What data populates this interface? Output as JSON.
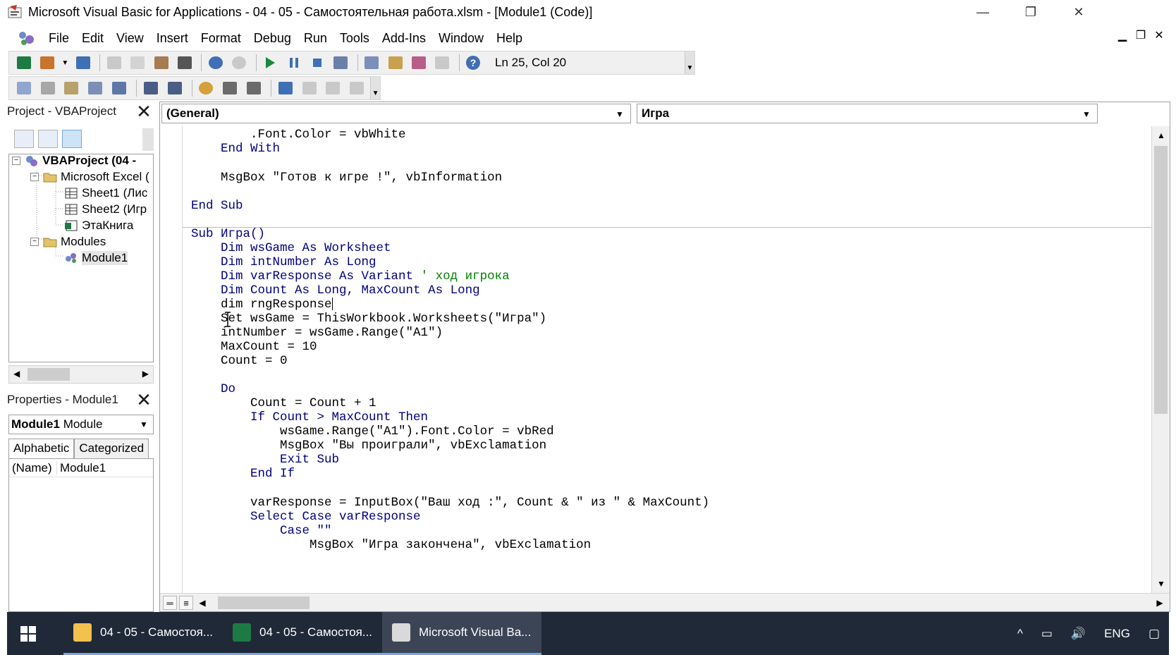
{
  "window": {
    "title": "Microsoft Visual Basic for Applications - 04 - 05 - Самостоятельная работа.xlsm - [Module1 (Code)]",
    "minimize": "—",
    "restore": "❐",
    "close": "✕"
  },
  "menu": [
    "File",
    "Edit",
    "View",
    "Insert",
    "Format",
    "Debug",
    "Run",
    "Tools",
    "Add-Ins",
    "Window",
    "Help"
  ],
  "mdi": {
    "minimize": "▁",
    "restore": "❐",
    "close": "✕"
  },
  "toolbar": {
    "position": "Ln 25, Col 20"
  },
  "project": {
    "title": "Project - VBAProject",
    "close": "✕",
    "tree": [
      {
        "label": "VBAProject (04 - "
      },
      {
        "label": "Microsoft Excel ("
      },
      {
        "label": "Sheet1 (Лис"
      },
      {
        "label": "Sheet2 (Игр"
      },
      {
        "label": "ЭтаКнига"
      },
      {
        "label": "Modules"
      },
      {
        "label": "Module1"
      }
    ],
    "expanders": [
      "−",
      "−",
      "−"
    ]
  },
  "properties": {
    "title": "Properties - Module1",
    "close": "✕",
    "object_name": "Module1",
    "object_type": "Module",
    "tabs": [
      "Alphabetic",
      "Categorized"
    ],
    "rows": [
      {
        "name": "(Name)",
        "value": "Module1"
      }
    ]
  },
  "code": {
    "object_combo": "(General)",
    "proc_combo": "Игра",
    "lines": {
      "l1": ".Font.Color = vbWhite",
      "l2": "End With",
      "l3": "MsgBox \"Готов к игре !\", vbInformation",
      "l4": "End Sub",
      "l5": "Sub Игра()",
      "l6": "Dim wsGame As Worksheet",
      "l7": "Dim intNumber As Long",
      "l8a": "Dim varResponse As Variant",
      "l8b": "' ход игрока",
      "l9": "Dim Count As Long, MaxCount As Long",
      "l10": "dim rngResponse",
      "l11": "Set wsGame = ThisWorkbook.Worksheets(\"Игра\")",
      "l12": "intNumber = wsGame.Range(\"A1\")",
      "l13": "MaxCount = 10",
      "l14": "Count = 0",
      "l15": "Do",
      "l16": "Count = Count + 1",
      "l17": "If Count > MaxCount Then",
      "l18": "wsGame.Range(\"A1\").Font.Color = vbRed",
      "l19": "MsgBox \"Вы проиграли\", vbExclamation",
      "l20": "Exit Sub",
      "l21": "End If",
      "l22": "varResponse = InputBox(\"Ваш ход :\", Count & \" из \" & MaxCount)",
      "l23": "Select Case varResponse",
      "l24": "Case \"\"",
      "l25": "MsgBox \"Игра закончена\", vbExclamation"
    }
  },
  "taskbar": {
    "items": [
      {
        "label": "04 - 05 - Самостоя...",
        "color": "#f2c14e"
      },
      {
        "label": "04 - 05 - Самостоя...",
        "color": "#1d7a45"
      },
      {
        "label": "Microsoft Visual Ba...",
        "color": "#d9d9d9"
      }
    ],
    "tray": {
      "lang": "ENG",
      "up_arrow": "^"
    }
  }
}
